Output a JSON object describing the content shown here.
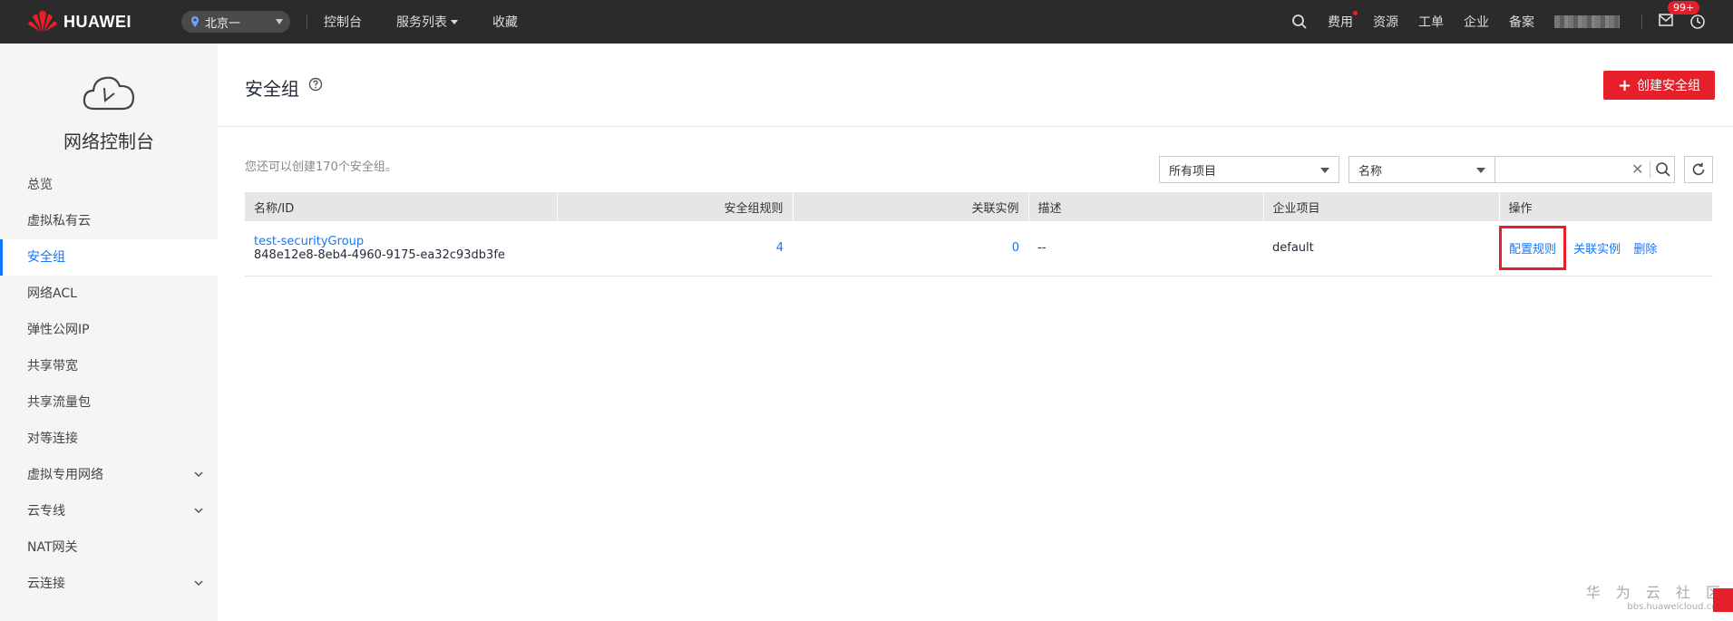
{
  "topbar": {
    "brand": "HUAWEI",
    "region": "北京一",
    "nav": [
      "控制台",
      "服务列表",
      "收藏"
    ],
    "right_items": [
      "费用",
      "资源",
      "工单",
      "企业",
      "备案"
    ],
    "badge": "99+"
  },
  "sidebar": {
    "title": "网络控制台",
    "items": [
      {
        "label": "总览"
      },
      {
        "label": "虚拟私有云"
      },
      {
        "label": "安全组"
      },
      {
        "label": "网络ACL"
      },
      {
        "label": "弹性公网IP"
      },
      {
        "label": "共享带宽"
      },
      {
        "label": "共享流量包"
      },
      {
        "label": "对等连接"
      },
      {
        "label": "虚拟专用网络"
      },
      {
        "label": "云专线"
      },
      {
        "label": "NAT网关"
      },
      {
        "label": "云连接"
      }
    ]
  },
  "main": {
    "title": "安全组",
    "create_label": "创建安全组",
    "quota_text": "您还可以创建170个安全组。",
    "project_filter": "所有项目",
    "search_field": "名称",
    "columns": [
      "名称/ID",
      "安全组规则",
      "关联实例",
      "描述",
      "企业项目",
      "操作"
    ],
    "rows": [
      {
        "name": "test-securityGroup",
        "id": "848e12e8-8eb4-4960-9175-ea32c93db3fe",
        "rules": "4",
        "instances": "0",
        "desc": "--",
        "project": "default",
        "ops": [
          "配置规则",
          "关联实例",
          "删除"
        ]
      }
    ]
  },
  "watermark": {
    "line1": "华 为 云 社 区",
    "line2": "bbs.huaweicloud.com"
  },
  "colors": {
    "accent": "#1476ff",
    "brand_red": "#e6202a",
    "topbar": "#2b2b2b"
  }
}
